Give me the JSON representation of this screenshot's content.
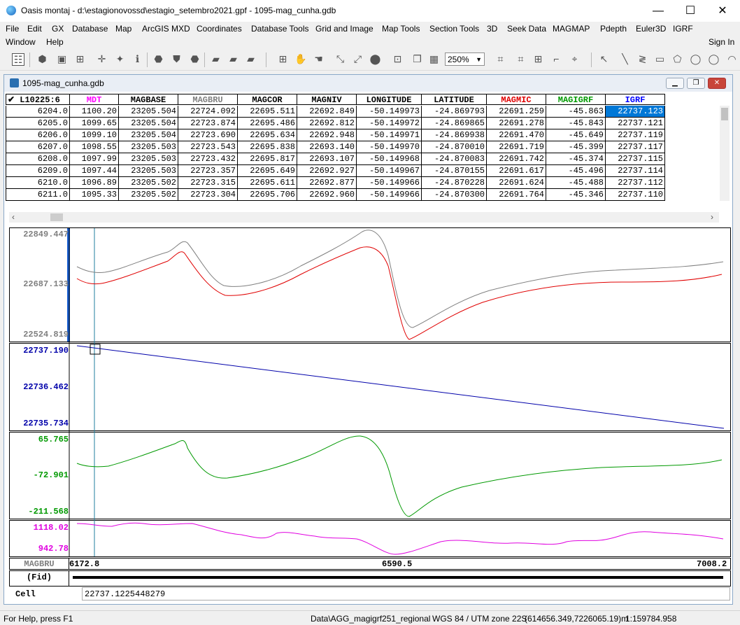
{
  "window": {
    "title": "Oasis montaj - d:\\estagionovossd\\estagio_setembro2021.gpf - 1095-mag_cunha.gdb",
    "controls": {
      "minimize": "—",
      "maximize": "☐",
      "close": "✕"
    }
  },
  "menu1": [
    "File",
    "Edit",
    "GX",
    "Database",
    "Map",
    "ArcGIS MXD",
    "Coordinates",
    "Database Tools",
    "Grid and Image",
    "Map Tools",
    "Section Tools",
    "3D",
    "Seek Data",
    "MAGMAP",
    "Pdepth",
    "Euler3D",
    "IGRF"
  ],
  "menu2": {
    "items": [
      "Window",
      "Help"
    ],
    "sign_in": "Sign In"
  },
  "toolbar": {
    "zoom": "250%"
  },
  "db": {
    "title": "1095-mag_cunha.gdb",
    "line": "✔ L10225:6",
    "columns": [
      {
        "name": "MDT",
        "color": "#ff00ff"
      },
      {
        "name": "MAGBASE",
        "color": "#000000"
      },
      {
        "name": "MAGBRU",
        "color": "#808080"
      },
      {
        "name": "MAGCOR",
        "color": "#000000"
      },
      {
        "name": "MAGNIV",
        "color": "#000000"
      },
      {
        "name": "LONGITUDE",
        "color": "#000000"
      },
      {
        "name": "LATITUDE",
        "color": "#000000"
      },
      {
        "name": "MAGMIC",
        "color": "#e00000"
      },
      {
        "name": "MAGIGRF",
        "color": "#009900"
      },
      {
        "name": "IGRF",
        "color": "#0000ff"
      }
    ],
    "rows": [
      [
        "6204.0",
        "1100.20",
        "23205.504",
        "22724.092",
        "22695.511",
        "22692.849",
        "-50.149973",
        "-24.869793",
        "22691.259",
        "-45.863",
        "22737.123"
      ],
      [
        "6205.0",
        "1099.65",
        "23205.504",
        "22723.874",
        "22695.486",
        "22692.812",
        "-50.149972",
        "-24.869865",
        "22691.278",
        "-45.843",
        "22737.121"
      ],
      [
        "6206.0",
        "1099.10",
        "23205.504",
        "22723.690",
        "22695.634",
        "22692.948",
        "-50.149971",
        "-24.869938",
        "22691.470",
        "-45.649",
        "22737.119"
      ],
      [
        "6207.0",
        "1098.55",
        "23205.503",
        "22723.543",
        "22695.838",
        "22693.140",
        "-50.149970",
        "-24.870010",
        "22691.719",
        "-45.399",
        "22737.117"
      ],
      [
        "6208.0",
        "1097.99",
        "23205.503",
        "22723.432",
        "22695.817",
        "22693.107",
        "-50.149968",
        "-24.870083",
        "22691.742",
        "-45.374",
        "22737.115"
      ],
      [
        "6209.0",
        "1097.44",
        "23205.503",
        "22723.357",
        "22695.649",
        "22692.927",
        "-50.149967",
        "-24.870155",
        "22691.617",
        "-45.496",
        "22737.114"
      ],
      [
        "6210.0",
        "1096.89",
        "23205.502",
        "22723.315",
        "22695.611",
        "22692.877",
        "-50.149966",
        "-24.870228",
        "22691.624",
        "-45.488",
        "22737.112"
      ],
      [
        "6211.0",
        "1095.33",
        "23205.502",
        "22723.304",
        "22695.706",
        "22692.960",
        "-50.149966",
        "-24.870300",
        "22691.764",
        "-45.346",
        "22737.110"
      ]
    ]
  },
  "profiles": {
    "panel1": {
      "labels": [
        "22849.447",
        "22687.133",
        "22524.819"
      ],
      "colors": [
        "#808080",
        "#e00000"
      ]
    },
    "panel2": {
      "labels": [
        "22737.190",
        "22736.462",
        "22735.734"
      ],
      "color": "#0000aa"
    },
    "panel3": {
      "labels": [
        "65.765",
        "-72.901",
        "-211.568"
      ],
      "color": "#009900"
    },
    "panel4": {
      "labels": [
        "1118.02",
        "942.78"
      ],
      "color": "#e000e0"
    }
  },
  "xaxis": {
    "channel": "MAGBRU",
    "start": "6172.8",
    "mid": "6590.5",
    "end": "7008.2",
    "fid_label": "(Fid)"
  },
  "cell": {
    "label": "Cell",
    "value": "22737.1225448279"
  },
  "status": {
    "help": "For Help, press F1",
    "data": "Data\\AGG_magigrf251_regional",
    "proj": "WGS 84 / UTM zone 22S",
    "coords": "(614656.349,7226065.19)m",
    "scale": "1:159784.958"
  }
}
